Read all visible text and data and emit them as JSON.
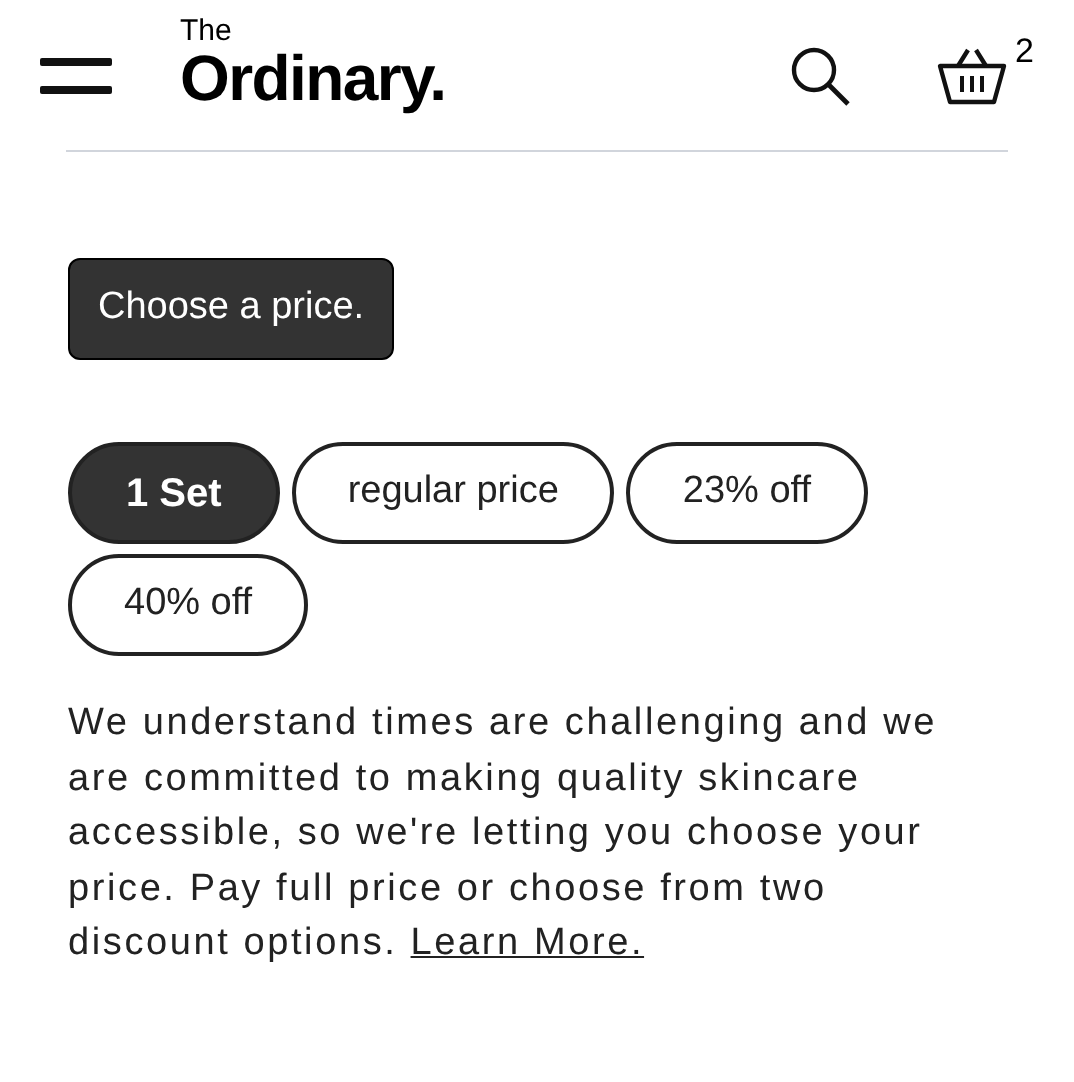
{
  "header": {
    "logo_top": "The",
    "logo": "Ordinary.",
    "cart_count": "2"
  },
  "price_button": "Choose a price.",
  "options": [
    {
      "label": "1 Set",
      "selected": true
    },
    {
      "label": "regular price",
      "selected": false
    },
    {
      "label": "23% off",
      "selected": false
    },
    {
      "label": "40% off",
      "selected": false
    }
  ],
  "description": "We understand times are challenging and we are committed to making quality skincare accessible, so we're letting you choose your price. Pay full price or choose from two discount options.",
  "link": "Learn More."
}
